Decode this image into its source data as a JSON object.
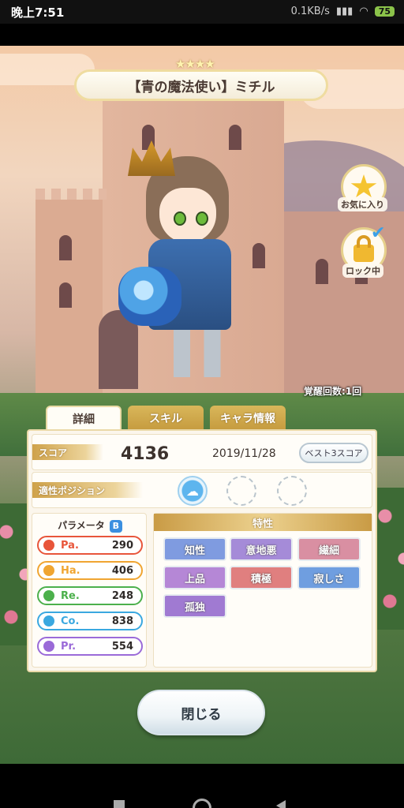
{
  "status_bar": {
    "time": "晚上7:51",
    "network": "0.1KB/s",
    "battery": "75"
  },
  "card": {
    "stars": "★★★★",
    "title": "【青の魔法使い】ミチル",
    "favorite_label": "お気に入り",
    "lock_label": "ロック中",
    "awaken_text": "覚醒回数:1回"
  },
  "tabs": [
    {
      "label": "詳細",
      "active": true
    },
    {
      "label": "スキル",
      "active": false
    },
    {
      "label": "キャラ情報",
      "active": false
    }
  ],
  "score": {
    "label": "スコア",
    "value": "4136",
    "date": "2019/11/28",
    "best3_label": "ベスト3スコア"
  },
  "position": {
    "label": "適性ポジション"
  },
  "parameters": {
    "title": "パラメータ",
    "rank": "B",
    "items": [
      {
        "name": "Pa.",
        "value": "290",
        "color": "#e8553a"
      },
      {
        "name": "Ha.",
        "value": "406",
        "color": "#f0a531"
      },
      {
        "name": "Re.",
        "value": "248",
        "color": "#4cb04c"
      },
      {
        "name": "Co.",
        "value": "838",
        "color": "#3aa8e0"
      },
      {
        "name": "Pr.",
        "value": "554",
        "color": "#9a6ad8"
      }
    ]
  },
  "traits": {
    "title": "特性",
    "items": [
      {
        "label": "知性",
        "color": "#7f9be0"
      },
      {
        "label": "意地悪",
        "color": "#a58bd8"
      },
      {
        "label": "繊細",
        "color": "#d98fa2"
      },
      {
        "label": "上品",
        "color": "#b587d6"
      },
      {
        "label": "積極",
        "color": "#e07f7f"
      },
      {
        "label": "寂しさ",
        "color": "#6f9ee0"
      },
      {
        "label": "孤独",
        "color": "#a07ad2"
      }
    ]
  },
  "close_label": "閉じる"
}
